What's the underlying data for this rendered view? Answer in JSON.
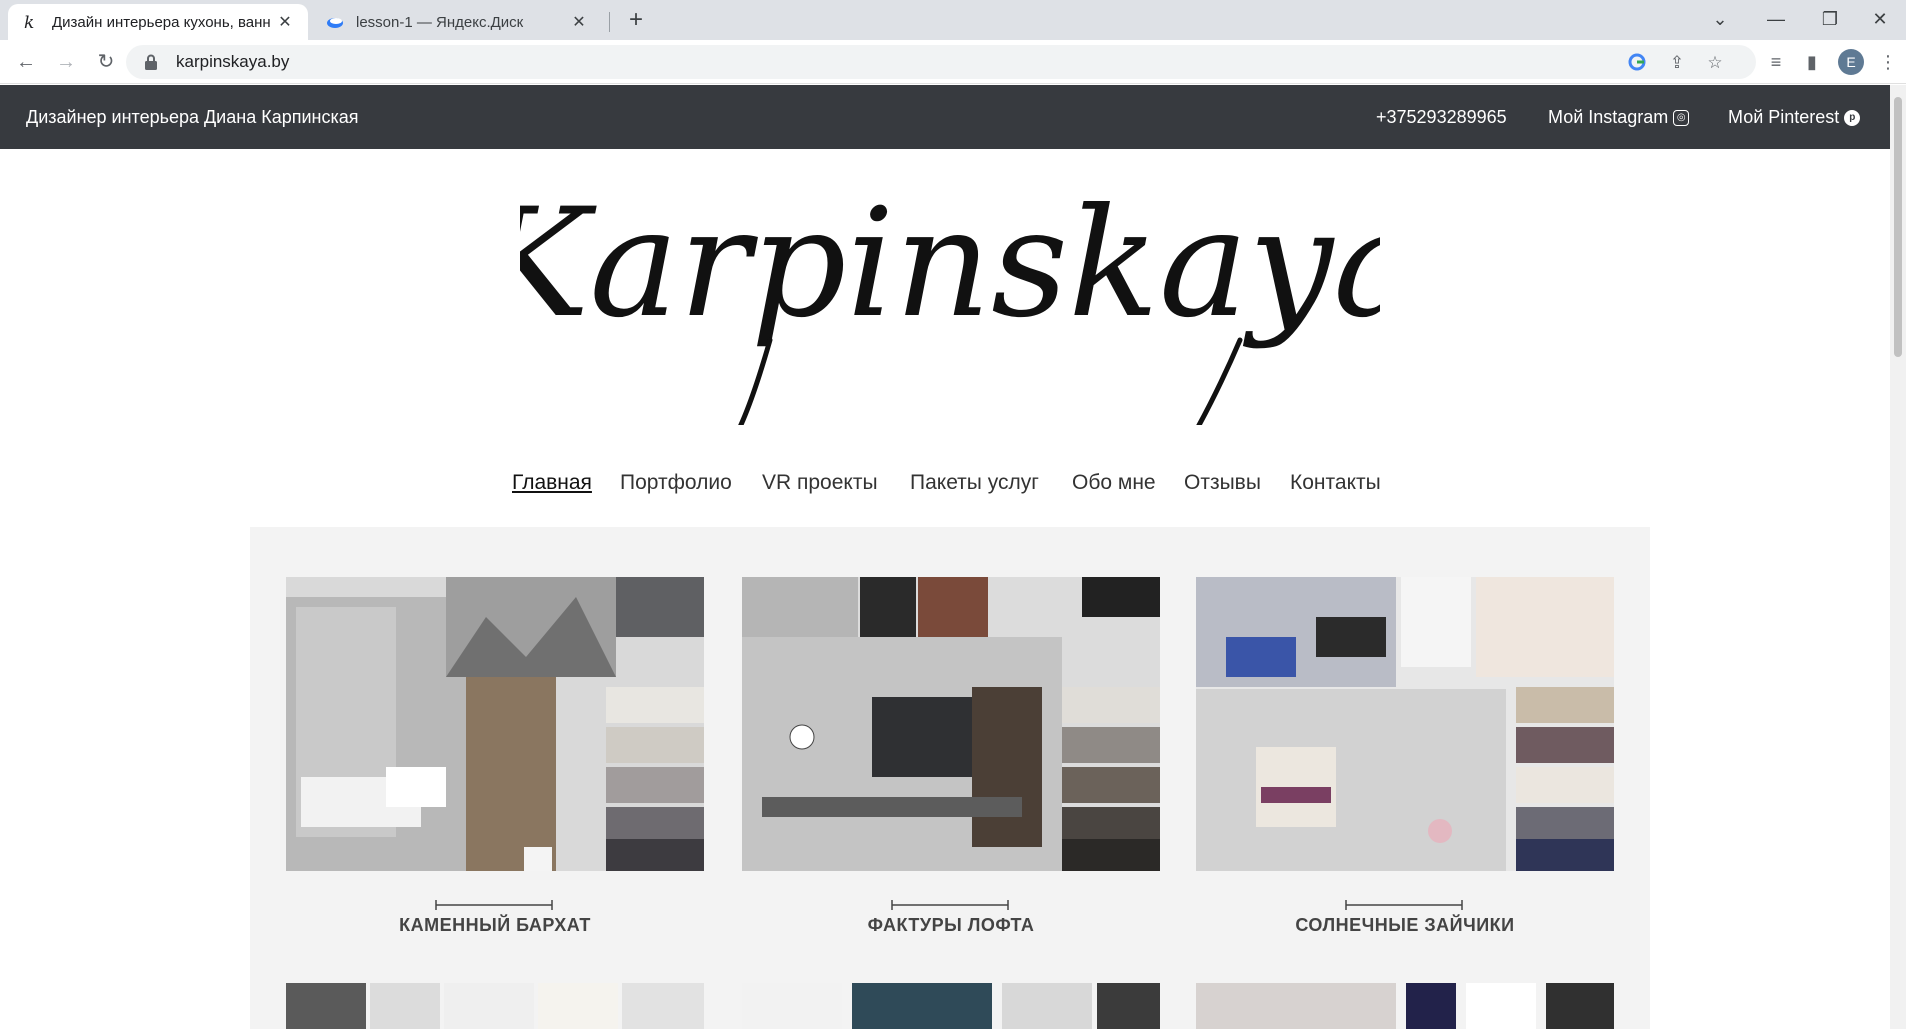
{
  "browser": {
    "tabs": [
      {
        "title": "Дизайн интерьера кухонь, ванн",
        "active": true
      },
      {
        "title": "lesson-1 — Яндекс.Диск",
        "active": false
      }
    ],
    "url": "karpinskaya.by",
    "profile_initial": "E"
  },
  "site": {
    "topbar": {
      "designer": "Дизайнер интерьера Диана Карпинская",
      "phone": "+375293289965",
      "instagram": "Мой Instagram",
      "pinterest": "Мой Pinterest"
    },
    "logo_text": "Karpinskaya",
    "nav": [
      "Главная",
      "Портфолио",
      "VR проекты",
      "Пакеты услуг",
      "Обо мне",
      "Отзывы",
      "Контакты"
    ],
    "nav_active": "Главная",
    "projects": [
      {
        "title": "КАМЕННЫЙ БАРХАТ"
      },
      {
        "title": "ФАКТУРЫ ЛОФТА"
      },
      {
        "title": "СОЛНЕЧНЫЕ ЗАЙЧИКИ"
      }
    ]
  },
  "colors": {
    "topbar_bg": "#373a3f",
    "accent_text": "#444444"
  }
}
